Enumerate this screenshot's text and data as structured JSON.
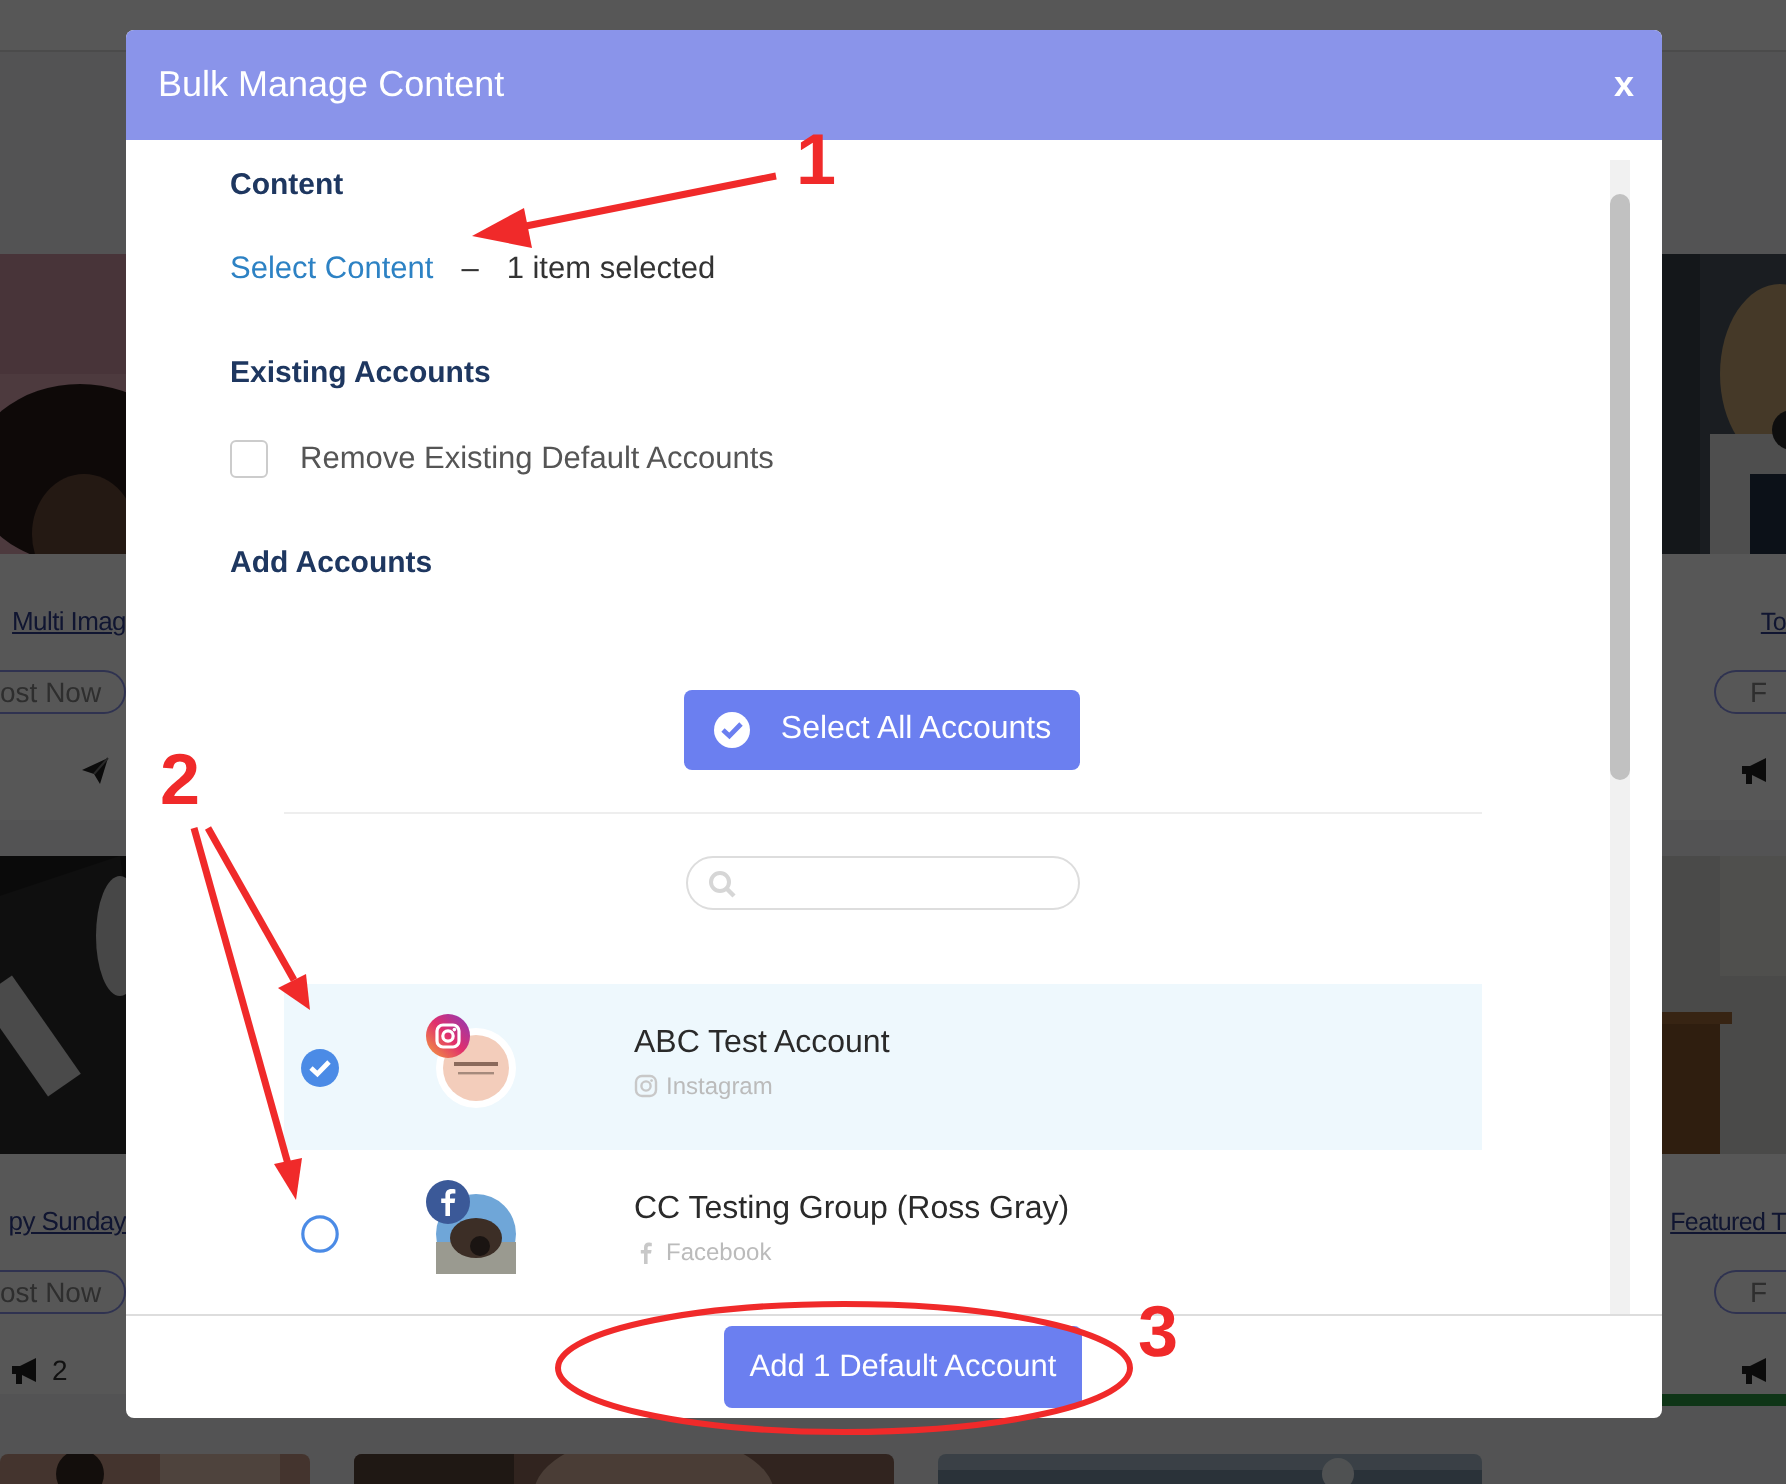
{
  "left_cards": [
    {
      "title": "Multi Imag",
      "button": "ost Now",
      "stats": [
        {
          "kind": "send"
        }
      ],
      "accent": false
    },
    {
      "title": "py Sunday",
      "button": "ost Now",
      "stats": [
        {
          "kind": "megaphone",
          "count": "2"
        }
      ],
      "accent": false
    }
  ],
  "right_cards": [
    {
      "title": "To",
      "button": "F",
      "stats": [
        {
          "kind": "megaphone"
        }
      ],
      "accent": false
    },
    {
      "title": "Featured T",
      "button": "F",
      "stats": [
        {
          "kind": "megaphone"
        }
      ],
      "accent": true
    }
  ],
  "modal": {
    "title": "Bulk Manage Content",
    "close": "x",
    "content": {
      "heading": "Content",
      "link": "Select Content",
      "separator": "–",
      "summary": "1 item selected"
    },
    "existing": {
      "heading": "Existing Accounts",
      "checkbox": {
        "label": "Remove Existing Default Accounts",
        "checked": false
      }
    },
    "add": {
      "heading": "Add Accounts",
      "select_all": "Select All Accounts"
    },
    "accounts": [
      {
        "name": "ABC Test Account",
        "platform": "Instagram",
        "kind": "instagram",
        "selected": true
      },
      {
        "name": "CC Testing Group (Ross Gray)",
        "platform": "Facebook",
        "kind": "facebook",
        "selected": false
      }
    ],
    "footer_button": "Add 1 Default Account"
  },
  "annotations": [
    {
      "label": "1"
    },
    {
      "label": "2"
    },
    {
      "label": "3"
    }
  ]
}
